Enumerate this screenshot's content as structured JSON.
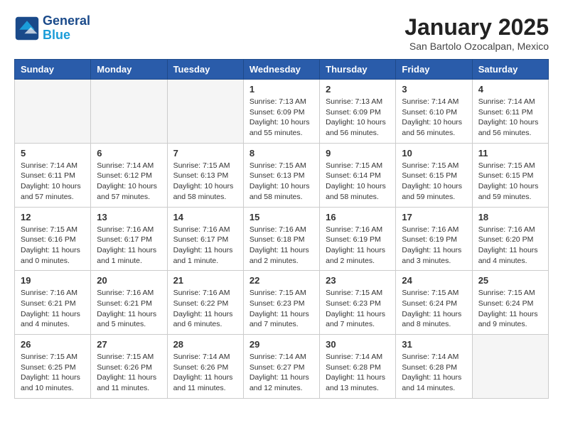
{
  "header": {
    "logo_line1": "General",
    "logo_line2": "Blue",
    "month": "January 2025",
    "location": "San Bartolo Ozocalpan, Mexico"
  },
  "weekdays": [
    "Sunday",
    "Monday",
    "Tuesday",
    "Wednesday",
    "Thursday",
    "Friday",
    "Saturday"
  ],
  "weeks": [
    [
      {
        "day": "",
        "content": ""
      },
      {
        "day": "",
        "content": ""
      },
      {
        "day": "",
        "content": ""
      },
      {
        "day": "1",
        "content": "Sunrise: 7:13 AM\nSunset: 6:09 PM\nDaylight: 10 hours\nand 55 minutes."
      },
      {
        "day": "2",
        "content": "Sunrise: 7:13 AM\nSunset: 6:09 PM\nDaylight: 10 hours\nand 56 minutes."
      },
      {
        "day": "3",
        "content": "Sunrise: 7:14 AM\nSunset: 6:10 PM\nDaylight: 10 hours\nand 56 minutes."
      },
      {
        "day": "4",
        "content": "Sunrise: 7:14 AM\nSunset: 6:11 PM\nDaylight: 10 hours\nand 56 minutes."
      }
    ],
    [
      {
        "day": "5",
        "content": "Sunrise: 7:14 AM\nSunset: 6:11 PM\nDaylight: 10 hours\nand 57 minutes."
      },
      {
        "day": "6",
        "content": "Sunrise: 7:14 AM\nSunset: 6:12 PM\nDaylight: 10 hours\nand 57 minutes."
      },
      {
        "day": "7",
        "content": "Sunrise: 7:15 AM\nSunset: 6:13 PM\nDaylight: 10 hours\nand 58 minutes."
      },
      {
        "day": "8",
        "content": "Sunrise: 7:15 AM\nSunset: 6:13 PM\nDaylight: 10 hours\nand 58 minutes."
      },
      {
        "day": "9",
        "content": "Sunrise: 7:15 AM\nSunset: 6:14 PM\nDaylight: 10 hours\nand 58 minutes."
      },
      {
        "day": "10",
        "content": "Sunrise: 7:15 AM\nSunset: 6:15 PM\nDaylight: 10 hours\nand 59 minutes."
      },
      {
        "day": "11",
        "content": "Sunrise: 7:15 AM\nSunset: 6:15 PM\nDaylight: 10 hours\nand 59 minutes."
      }
    ],
    [
      {
        "day": "12",
        "content": "Sunrise: 7:15 AM\nSunset: 6:16 PM\nDaylight: 11 hours\nand 0 minutes."
      },
      {
        "day": "13",
        "content": "Sunrise: 7:16 AM\nSunset: 6:17 PM\nDaylight: 11 hours\nand 1 minute."
      },
      {
        "day": "14",
        "content": "Sunrise: 7:16 AM\nSunset: 6:17 PM\nDaylight: 11 hours\nand 1 minute."
      },
      {
        "day": "15",
        "content": "Sunrise: 7:16 AM\nSunset: 6:18 PM\nDaylight: 11 hours\nand 2 minutes."
      },
      {
        "day": "16",
        "content": "Sunrise: 7:16 AM\nSunset: 6:19 PM\nDaylight: 11 hours\nand 2 minutes."
      },
      {
        "day": "17",
        "content": "Sunrise: 7:16 AM\nSunset: 6:19 PM\nDaylight: 11 hours\nand 3 minutes."
      },
      {
        "day": "18",
        "content": "Sunrise: 7:16 AM\nSunset: 6:20 PM\nDaylight: 11 hours\nand 4 minutes."
      }
    ],
    [
      {
        "day": "19",
        "content": "Sunrise: 7:16 AM\nSunset: 6:21 PM\nDaylight: 11 hours\nand 4 minutes."
      },
      {
        "day": "20",
        "content": "Sunrise: 7:16 AM\nSunset: 6:21 PM\nDaylight: 11 hours\nand 5 minutes."
      },
      {
        "day": "21",
        "content": "Sunrise: 7:16 AM\nSunset: 6:22 PM\nDaylight: 11 hours\nand 6 minutes."
      },
      {
        "day": "22",
        "content": "Sunrise: 7:15 AM\nSunset: 6:23 PM\nDaylight: 11 hours\nand 7 minutes."
      },
      {
        "day": "23",
        "content": "Sunrise: 7:15 AM\nSunset: 6:23 PM\nDaylight: 11 hours\nand 7 minutes."
      },
      {
        "day": "24",
        "content": "Sunrise: 7:15 AM\nSunset: 6:24 PM\nDaylight: 11 hours\nand 8 minutes."
      },
      {
        "day": "25",
        "content": "Sunrise: 7:15 AM\nSunset: 6:24 PM\nDaylight: 11 hours\nand 9 minutes."
      }
    ],
    [
      {
        "day": "26",
        "content": "Sunrise: 7:15 AM\nSunset: 6:25 PM\nDaylight: 11 hours\nand 10 minutes."
      },
      {
        "day": "27",
        "content": "Sunrise: 7:15 AM\nSunset: 6:26 PM\nDaylight: 11 hours\nand 11 minutes."
      },
      {
        "day": "28",
        "content": "Sunrise: 7:14 AM\nSunset: 6:26 PM\nDaylight: 11 hours\nand 11 minutes."
      },
      {
        "day": "29",
        "content": "Sunrise: 7:14 AM\nSunset: 6:27 PM\nDaylight: 11 hours\nand 12 minutes."
      },
      {
        "day": "30",
        "content": "Sunrise: 7:14 AM\nSunset: 6:28 PM\nDaylight: 11 hours\nand 13 minutes."
      },
      {
        "day": "31",
        "content": "Sunrise: 7:14 AM\nSunset: 6:28 PM\nDaylight: 11 hours\nand 14 minutes."
      },
      {
        "day": "",
        "content": ""
      }
    ]
  ]
}
